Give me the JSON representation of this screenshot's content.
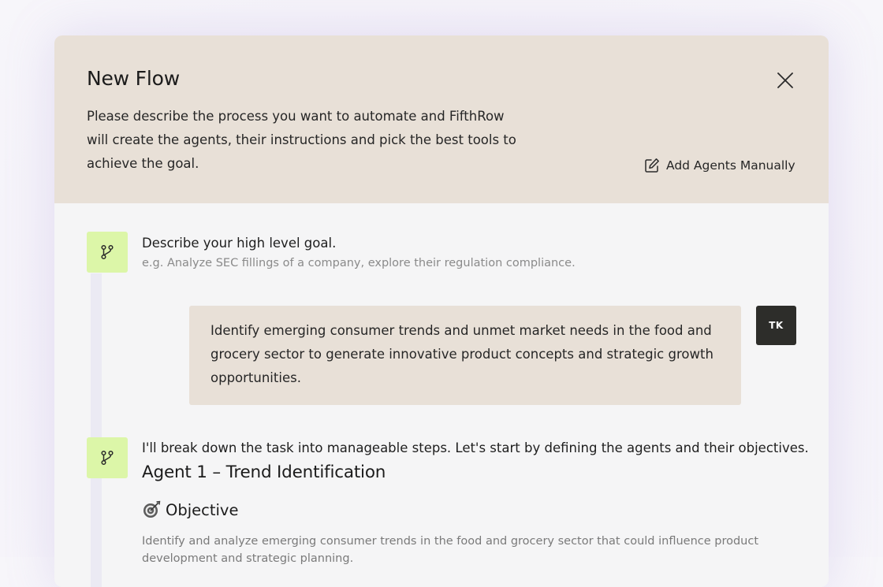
{
  "modal": {
    "title": "New Flow",
    "description": "Please describe the process you want to automate and FifthRow will create the agents, their instructions and pick the best tools to achieve the goal.",
    "close_icon": "close-icon",
    "add_manual_label": "Add Agents Manually",
    "add_manual_icon": "edit-icon"
  },
  "goal_step": {
    "icon": "branch-icon",
    "label": "Describe your high level goal.",
    "hint": "e.g. Analyze SEC fillings of a company, explore their regulation compliance."
  },
  "user_message": {
    "text": "Identify emerging consumer trends and unmet market needs in the food and grocery sector to generate innovative product concepts and strategic growth opportunities.",
    "avatar_initials": "TK"
  },
  "assistant_reply": {
    "icon": "branch-icon",
    "intro": "I'll break down the task into manageable steps. Let's start by defining the agents and their objectives.",
    "agent_heading": "Agent 1 – Trend Identification",
    "objective_emoji": "🎯",
    "objective_heading": "Objective",
    "objective_text": "Identify and analyze emerging consumer trends in the food and grocery sector that could influence product development and strategic planning."
  },
  "colors": {
    "header_bg": "#e8e0d7",
    "step_icon_bg": "#dcf6a8",
    "avatar_bg": "#2d2d2a",
    "modal_bg": "#f5f5f6"
  }
}
